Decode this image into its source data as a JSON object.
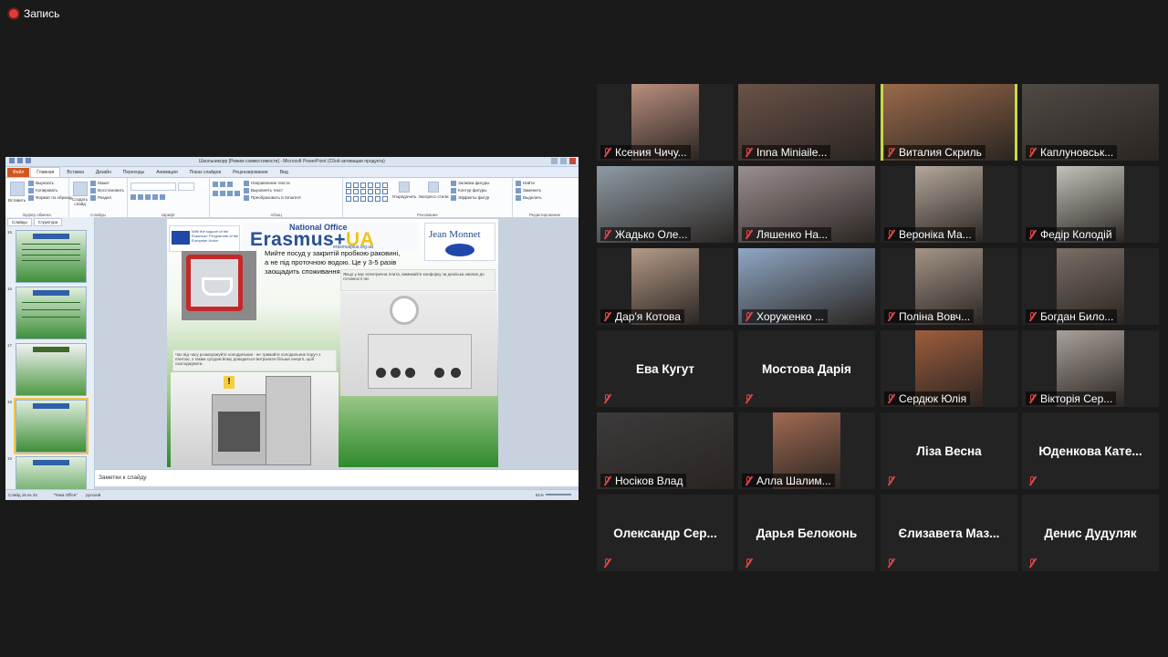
{
  "recording": {
    "label": "Запись"
  },
  "presentation": {
    "window_title": "Школьникорр [Режим совместимости] - Microsoft PowerPoint (Сбой активации продукта)",
    "tabs": [
      "Файл",
      "Главная",
      "Вставка",
      "Дизайн",
      "Переходы",
      "Анимация",
      "Показ слайдов",
      "Рецензирование",
      "Вид"
    ],
    "active_tab": "Главная",
    "ribbon": {
      "clipboard": {
        "paste": "Вставить",
        "cut": "Вырезать",
        "copy": "Копировать",
        "format": "Формат по образцу",
        "group": "Буфер обмена"
      },
      "slides": {
        "new": "Создать слайд",
        "layout": "Макет",
        "reset": "Восстановить",
        "section": "Раздел",
        "group": "Слайды"
      },
      "font": {
        "group": "Шрифт"
      },
      "paragraph": {
        "direction": "Направление текста",
        "align": "Выровнять текст",
        "smartart": "Преобразовать в SmartArt",
        "group": "Абзац"
      },
      "drawing": {
        "arrange": "Упорядочить",
        "quick_styles": "Экспресс-стили",
        "fill": "Заливка фигуры",
        "outline": "Контур фигуры",
        "effects": "Эффекты фигур",
        "group": "Рисование"
      },
      "editing": {
        "find": "Найти",
        "replace": "Заменить",
        "select": "Выделить",
        "group": "Редактирование"
      }
    },
    "left_panel_tabs": [
      "Слайды",
      "Структура"
    ],
    "thumbnails": [
      "15",
      "16",
      "17",
      "18",
      "19"
    ],
    "selected_thumbnail": "18",
    "slide": {
      "eu_logo_text": "With the support of the Erasmus+ Programme of the European Union",
      "erasmus_top": "National Office",
      "erasmus_main": "Erasmus+",
      "erasmus_main_accent": "UA",
      "erasmus_url": "erasmusplus.org.ua",
      "jean_monnet": "Jean Monnet",
      "main_text": "Мийте посуд у закритій пробкою раковині, а не під проточною водою. Це у 3-5 разів заощадить споживання води.",
      "note_top": "Якщо у вас електрична плита, вимикайте конфорку за декілька хвилин до готовності їжі.",
      "note_bottom": "Час від часу розморожуйте холодильник - не тримайте холодильник поруч з плитою, з таким сусідом йому доводиться витрачати більше енергії, щоб охолоджувати."
    },
    "notes_placeholder": "Заметки к слайду",
    "status": {
      "slide": "Слайд 18 из 34",
      "theme": "\"Тема Office\"",
      "lang": "русский",
      "zoom": "81%"
    }
  },
  "participants": [
    {
      "name": "Ксения Чичу...",
      "video": true,
      "active": false,
      "bg": "#b98e7e"
    },
    {
      "name": "Inna Miniaile...",
      "video": true,
      "active": false,
      "bg": "#6a5247"
    },
    {
      "name": "Виталия Скриль",
      "video": true,
      "active": true,
      "bg": "#9a6a4a"
    },
    {
      "name": "Каплуновськ...",
      "video": true,
      "active": false,
      "bg": "#4f4a44"
    },
    {
      "name": "Жадько Оле...",
      "video": true,
      "active": false,
      "bg": "#8e9aa3"
    },
    {
      "name": "Ляшенко На...",
      "video": true,
      "active": false,
      "bg": "#9a8e8e"
    },
    {
      "name": "Вероніка Ма...",
      "video": true,
      "active": false,
      "bg": "#b4a79a"
    },
    {
      "name": "Федір Колодій",
      "video": true,
      "active": false,
      "bg": "#c3c1b8"
    },
    {
      "name": "Дар'я Котова",
      "video": true,
      "active": false,
      "bg": "#b49a87"
    },
    {
      "name": "Хоруженко ...",
      "video": true,
      "active": false,
      "bg": "#8fa7c4"
    },
    {
      "name": "Поліна Вовч...",
      "video": true,
      "active": false,
      "bg": "#a49486"
    },
    {
      "name": "Богдан Било...",
      "video": true,
      "active": false,
      "bg": "#7a6e64"
    },
    {
      "name": "Ева Кугут",
      "video": false,
      "active": false
    },
    {
      "name": "Мостова Дарія",
      "video": false,
      "active": false
    },
    {
      "name": "Сердюк Юлія",
      "video": true,
      "active": false,
      "bg": "#9e5d3c"
    },
    {
      "name": "Вікторія Сер...",
      "video": true,
      "active": false,
      "bg": "#a8a09a"
    },
    {
      "name": "Носіков Влад",
      "video": true,
      "active": false,
      "bg": "#3c3a3b"
    },
    {
      "name": "Алла Шалим...",
      "video": true,
      "active": false,
      "bg": "#a06a52"
    },
    {
      "name": "Ліза Весна",
      "video": false,
      "active": false
    },
    {
      "name": "Юденкова  Кате...",
      "video": false,
      "active": false
    },
    {
      "name": "Олександр   Сер...",
      "video": false,
      "active": false
    },
    {
      "name": "Дарья Белоконь",
      "video": false,
      "active": false
    },
    {
      "name": "Єлизавета  Маз...",
      "video": false,
      "active": false
    },
    {
      "name": "Денис Дудуляк",
      "video": false,
      "active": false
    }
  ]
}
